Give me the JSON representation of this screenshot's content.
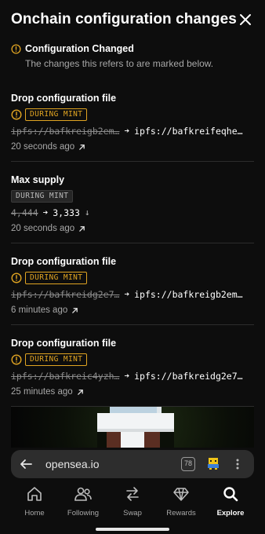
{
  "header": {
    "title": "Onchain configuration changes"
  },
  "notice": {
    "title": "Configuration Changed",
    "description": "The changes this refers to are marked below."
  },
  "entries": [
    {
      "name": "Drop configuration file",
      "tag": "DURING MINT",
      "tag_style": "warning",
      "old_value": "ipfs://bafkreigb2em…",
      "new_value": "ipfs://bafkreifeqhe…",
      "time": "20 seconds ago"
    },
    {
      "name": "Max supply",
      "tag": "DURING MINT",
      "tag_style": "neutral",
      "old_value": "4,444",
      "new_value": "3,333",
      "time": "20 seconds ago"
    },
    {
      "name": "Drop configuration file",
      "tag": "DURING MINT",
      "tag_style": "warning",
      "old_value": "ipfs://bafkreidg2e7…",
      "new_value": "ipfs://bafkreigb2em…",
      "time": "6 minutes ago"
    },
    {
      "name": "Drop configuration file",
      "tag": "DURING MINT",
      "tag_style": "warning",
      "old_value": "ipfs://bafkreic4yzh…",
      "new_value": "ipfs://bafkreidg2e7…",
      "time": "25 minutes ago"
    }
  ],
  "browser": {
    "url": "opensea.io",
    "tab_count": "78"
  },
  "nav": {
    "items": [
      {
        "label": "Home",
        "icon": "home-icon"
      },
      {
        "label": "Following",
        "icon": "people-icon"
      },
      {
        "label": "Swap",
        "icon": "swap-icon"
      },
      {
        "label": "Rewards",
        "icon": "diamond-icon"
      },
      {
        "label": "Explore",
        "icon": "search-icon",
        "active": true
      }
    ]
  },
  "colors": {
    "warning": "#e0a422",
    "background": "#0d0d0d",
    "divider": "#2c2c2c"
  }
}
